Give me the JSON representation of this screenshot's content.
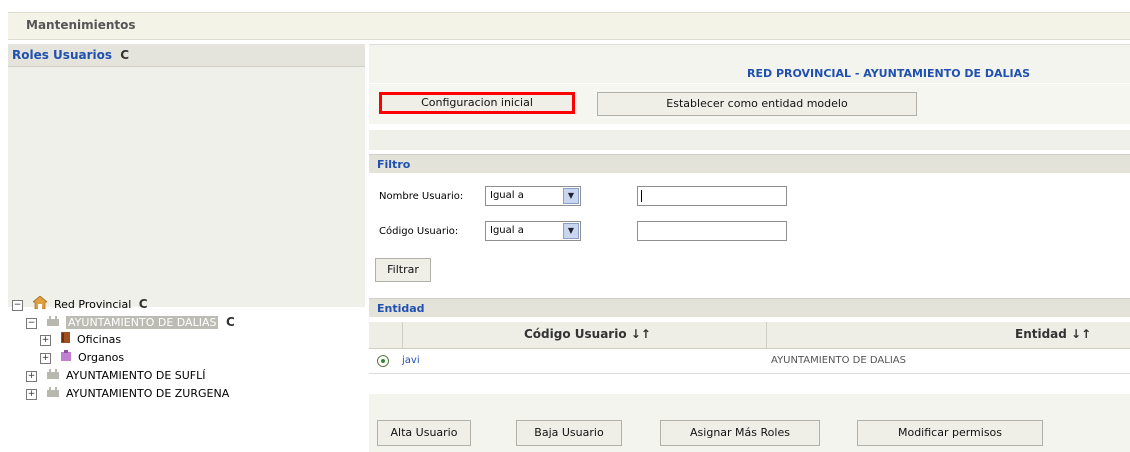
{
  "header": {
    "title": "Mantenimientos"
  },
  "left_panel": {
    "title": "Roles Usuarios",
    "refresh_icon": "C",
    "tree": [
      {
        "label": "Red Provincial",
        "toggle": "−",
        "icon": "house-icon",
        "refresh": "C"
      },
      {
        "label": "AYUNTAMIENTO DE DALIAS",
        "toggle": "−",
        "icon": "building-icon",
        "refresh": "C",
        "selected": true
      },
      {
        "label": "Oficinas",
        "toggle": "+",
        "icon": "book-icon"
      },
      {
        "label": "Organos",
        "toggle": "+",
        "icon": "org-icon"
      },
      {
        "label": "AYUNTAMIENTO DE SUFLÍ",
        "toggle": "+",
        "icon": "building-icon"
      },
      {
        "label": "AYUNTAMIENTO DE ZURGENA",
        "toggle": "+",
        "icon": "building-icon"
      }
    ]
  },
  "main": {
    "entity_title": "RED PROVINCIAL - AYUNTAMIENTO DE DALIAS",
    "buttons": {
      "config": "Configuracion inicial",
      "model": "Establecer como entidad modelo"
    },
    "filter": {
      "title": "Filtro",
      "nombre_label": "Nombre Usuario:",
      "codigo_label": "Código Usuario:",
      "nombre_op": "Igual a",
      "codigo_op": "Igual a",
      "nombre_value": "",
      "codigo_value": "",
      "button": "Filtrar"
    },
    "entity_section": {
      "title": "Entidad"
    },
    "table": {
      "columns": [
        "Código Usuario ↓↑",
        "Entidad ↓↑"
      ],
      "rows": [
        {
          "codigo": "javi",
          "entidad": "AYUNTAMIENTO DE DALIAS"
        }
      ]
    },
    "actions": {
      "alta": "Alta Usuario",
      "baja": "Baja Usuario",
      "roles": "Asignar Más Roles",
      "permisos": "Modificar permisos"
    }
  }
}
